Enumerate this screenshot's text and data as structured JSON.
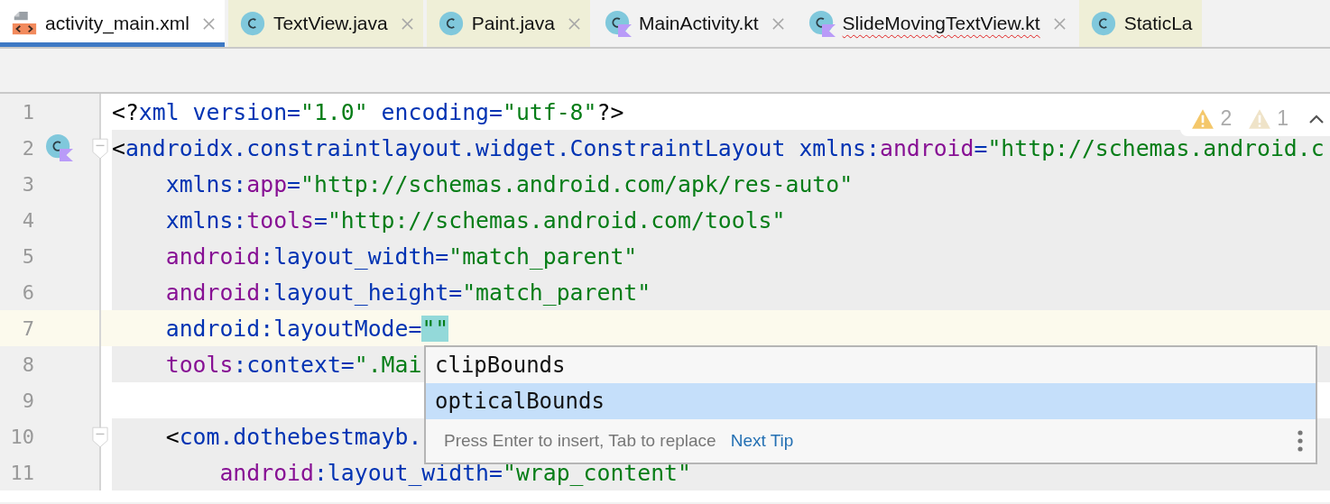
{
  "tabs": [
    {
      "label": "activity_main.xml",
      "kind": "xml",
      "selected": true,
      "closable": true,
      "error": false,
      "color": "#ffffff"
    },
    {
      "label": "TextView.java",
      "kind": "java",
      "selected": false,
      "closable": true,
      "error": false,
      "color": "#efefd7"
    },
    {
      "label": "Paint.java",
      "kind": "java",
      "selected": false,
      "closable": true,
      "error": false,
      "color": "#efefd7"
    },
    {
      "label": "MainActivity.kt",
      "kind": "kotlin",
      "selected": false,
      "closable": true,
      "error": false,
      "color": "#f2f2f2"
    },
    {
      "label": "SlideMovingTextView.kt",
      "kind": "kotlin",
      "selected": false,
      "closable": true,
      "error": true,
      "color": "#f2f2f2"
    },
    {
      "label": "StaticLa",
      "kind": "java",
      "selected": false,
      "closable": false,
      "error": false,
      "color": "#efefd7"
    }
  ],
  "inspections": {
    "warnings": "2",
    "weak_warnings": "1"
  },
  "lines": [
    {
      "number": "1",
      "current": false,
      "fold": false,
      "gutter_icon": false,
      "block": false,
      "tokens": [
        {
          "kind": "punct",
          "text": "<?"
        },
        {
          "kind": "tag",
          "text": "xml version="
        },
        {
          "kind": "value",
          "text": "\"1.0\""
        },
        {
          "kind": "tag",
          "text": " encoding="
        },
        {
          "kind": "value",
          "text": "\"utf-8\""
        },
        {
          "kind": "punct",
          "text": "?>"
        }
      ]
    },
    {
      "number": "2",
      "current": false,
      "fold": true,
      "gutter_icon": true,
      "block": true,
      "tokens": [
        {
          "kind": "punct",
          "text": "<"
        },
        {
          "kind": "tag",
          "text": "androidx.constraintlayout.widget.ConstraintLayout "
        },
        {
          "kind": "tag",
          "text": "xmlns:"
        },
        {
          "kind": "ns",
          "text": "android"
        },
        {
          "kind": "tag",
          "text": "="
        },
        {
          "kind": "value",
          "text": "\"http://schemas.android.c"
        }
      ]
    },
    {
      "number": "3",
      "current": false,
      "fold": false,
      "gutter_icon": false,
      "block": true,
      "tokens": [
        {
          "kind": "tag",
          "text": "    xmlns:"
        },
        {
          "kind": "ns",
          "text": "app"
        },
        {
          "kind": "tag",
          "text": "="
        },
        {
          "kind": "value",
          "text": "\"http://schemas.android.com/apk/res-auto\""
        }
      ]
    },
    {
      "number": "4",
      "current": false,
      "fold": false,
      "gutter_icon": false,
      "block": true,
      "tokens": [
        {
          "kind": "tag",
          "text": "    xmlns:"
        },
        {
          "kind": "ns",
          "text": "tools"
        },
        {
          "kind": "tag",
          "text": "="
        },
        {
          "kind": "value",
          "text": "\"http://schemas.android.com/tools\""
        }
      ]
    },
    {
      "number": "5",
      "current": false,
      "fold": false,
      "gutter_icon": false,
      "block": true,
      "tokens": [
        {
          "kind": "ns",
          "text": "    android"
        },
        {
          "kind": "tag",
          "text": ":layout_width="
        },
        {
          "kind": "value",
          "text": "\"match_parent\""
        }
      ]
    },
    {
      "number": "6",
      "current": false,
      "fold": false,
      "gutter_icon": false,
      "block": true,
      "tokens": [
        {
          "kind": "ns",
          "text": "    android"
        },
        {
          "kind": "tag",
          "text": ":layout_height="
        },
        {
          "kind": "value",
          "text": "\"match_parent\""
        }
      ]
    },
    {
      "number": "7",
      "current": true,
      "fold": false,
      "gutter_icon": false,
      "block": false,
      "tokens": [
        {
          "kind": "tag",
          "text": "    android:layoutMode="
        },
        {
          "kind": "match",
          "text": "\"\""
        }
      ]
    },
    {
      "number": "8",
      "current": false,
      "fold": false,
      "gutter_icon": false,
      "block": true,
      "tokens": [
        {
          "kind": "ns",
          "text": "    tools"
        },
        {
          "kind": "tag",
          "text": ":context="
        },
        {
          "kind": "value",
          "text": "\".Mai"
        }
      ]
    },
    {
      "number": "9",
      "current": false,
      "fold": false,
      "gutter_icon": false,
      "block": false
    },
    {
      "number": "10",
      "current": false,
      "fold": true,
      "gutter_icon": false,
      "block": true,
      "tokens": [
        {
          "kind": "punct",
          "text": "    <"
        },
        {
          "kind": "tag",
          "text": "com.dothebestmayb."
        }
      ]
    },
    {
      "number": "11",
      "current": false,
      "fold": false,
      "gutter_icon": false,
      "block": true,
      "tokens": [
        {
          "kind": "ns",
          "text": "        android"
        },
        {
          "kind": "tag",
          "text": ":layout_width="
        },
        {
          "kind": "value",
          "text": "\"wrap_content\""
        }
      ]
    }
  ],
  "completion": {
    "items": [
      {
        "label": "clipBounds",
        "selected": false
      },
      {
        "label": "opticalBounds",
        "selected": true
      }
    ],
    "hint": "Press Enter to insert, Tab to replace",
    "next_tip": "Next Tip"
  }
}
